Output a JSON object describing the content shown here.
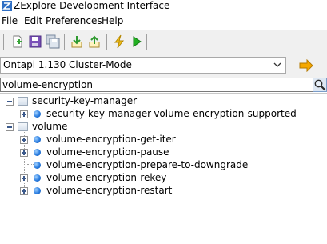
{
  "window": {
    "title": "ZExplore Development Interface"
  },
  "menu": [
    "File",
    "Edit",
    "Preferences",
    "Help"
  ],
  "toolbar": {
    "icons": [
      "new-document-icon",
      "save-icon",
      "save-all-icon",
      "download-icon",
      "upload-icon",
      "lightning-icon",
      "run-icon"
    ]
  },
  "server": {
    "selected": "Ontapi 1.130 Cluster-Mode"
  },
  "search": {
    "value": "volume-encryption"
  },
  "tree": {
    "groups": [
      {
        "label": "security-key-manager",
        "children": [
          "security-key-manager-volume-encryption-supported"
        ]
      },
      {
        "label": "volume",
        "children": [
          "volume-encryption-get-iter",
          "volume-encryption-pause",
          "volume-encryption-prepare-to-downgrade",
          "volume-encryption-rekey",
          "volume-encryption-restart"
        ]
      }
    ]
  },
  "colors": {
    "toolbar_bg": "#f0f0f0",
    "node_blue": "#2b7de0",
    "go_arrow": "#f0a000"
  }
}
